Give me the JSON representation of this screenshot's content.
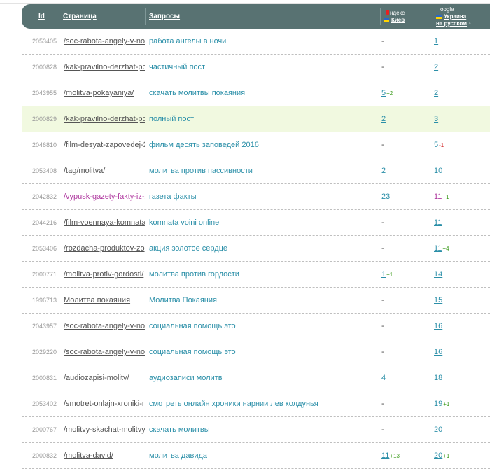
{
  "header": {
    "id": "Id",
    "page": "Страница",
    "query": "Запросы",
    "yandex": {
      "name": "ндекс",
      "region": "Киев"
    },
    "google": {
      "name": "oogle",
      "region_line1": "Украина",
      "region_line2": "на русском",
      "sort_arrow": "↑"
    }
  },
  "rows": [
    {
      "id": "2053405",
      "page": "/soc-rabota-angely-v-no",
      "query": "работа ангелы в ночи",
      "yandex": "-",
      "yandex_delta": "",
      "google": "1",
      "google_delta": ""
    },
    {
      "id": "2000828",
      "page": "/kak-pravilno-derzhat-pc",
      "query": "частичный пост",
      "yandex": "-",
      "yandex_delta": "",
      "google": "2",
      "google_delta": ""
    },
    {
      "id": "2043955",
      "page": "/molitva-pokayaniya/",
      "query": "скачать молитвы покаяния",
      "yandex": "5",
      "yandex_delta": "+2",
      "google": "2",
      "google_delta": ""
    },
    {
      "id": "2000829",
      "page": "/kak-pravilno-derzhat-pc",
      "query": "полный пост",
      "yandex": "2",
      "yandex_delta": "",
      "google": "3",
      "google_delta": ""
    },
    {
      "id": "2046810",
      "page": "/film-desyat-zapovedej-2",
      "query": "фильм десять заповедей 2016",
      "yandex": "-",
      "yandex_delta": "",
      "google": "5",
      "google_delta": "-1"
    },
    {
      "id": "2053408",
      "page": "/tag/molitva/",
      "query": "молитва против пассивности",
      "yandex": "2",
      "yandex_delta": "",
      "google": "10",
      "google_delta": ""
    },
    {
      "id": "2042832",
      "page": "/vypusk-gazety-fakty-iz-z",
      "query": "газета факты",
      "yandex": "23",
      "yandex_delta": "",
      "google": "11",
      "google_delta": "+1"
    },
    {
      "id": "2044216",
      "page": "/film-voennaya-komnata",
      "query": "komnata voini online",
      "yandex": "-",
      "yandex_delta": "",
      "google": "11",
      "google_delta": ""
    },
    {
      "id": "2053406",
      "page": "/rozdacha-produktov-zo",
      "query": "акция золотое сердце",
      "yandex": "-",
      "yandex_delta": "",
      "google": "11",
      "google_delta": "+4"
    },
    {
      "id": "2000771",
      "page": "/molitva-protiv-gordosti/",
      "query": "молитва против гордости",
      "yandex": "1",
      "yandex_delta": "+1",
      "google": "14",
      "google_delta": ""
    },
    {
      "id": "1996713",
      "page": "Молитва покаяния",
      "query": "Молитва Покаяния",
      "yandex": "-",
      "yandex_delta": "",
      "google": "15",
      "google_delta": ""
    },
    {
      "id": "2043957",
      "page": "/soc-rabota-angely-v-no",
      "query": "социальная помощь это",
      "yandex": "-",
      "yandex_delta": "",
      "google": "16",
      "google_delta": ""
    },
    {
      "id": "2029220",
      "page": "/soc-rabota-angely-v-no",
      "query": "социальная помощь это",
      "yandex": "-",
      "yandex_delta": "",
      "google": "16",
      "google_delta": ""
    },
    {
      "id": "2000831",
      "page": "/audiozapisi-molitv/",
      "query": "аудиозаписи молитв",
      "yandex": "4",
      "yandex_delta": "",
      "google": "18",
      "google_delta": ""
    },
    {
      "id": "2053402",
      "page": "/smotret-onlajn-xroniki-n",
      "query": "смотреть онлайн хроники нарнии лев колдунья",
      "yandex": "-",
      "yandex_delta": "",
      "google": "19",
      "google_delta": "+1"
    },
    {
      "id": "2000767",
      "page": "/molitvy-skachat-molitvy/",
      "query": "скачать молитвы",
      "yandex": "-",
      "yandex_delta": "",
      "google": "20",
      "google_delta": ""
    },
    {
      "id": "2000832",
      "page": "/molitva-david/",
      "query": "молитва давида",
      "yandex": "11",
      "yandex_delta": "+13",
      "google": "20",
      "google_delta": "+1"
    }
  ],
  "colors": {
    "header_bg": "#587272",
    "highlight_row": "#f1f9e0",
    "query_text": "#2b8fa8",
    "visited_link": "#b03aa0",
    "delta_up": "#3a9a1a",
    "delta_down": "#d02020"
  }
}
